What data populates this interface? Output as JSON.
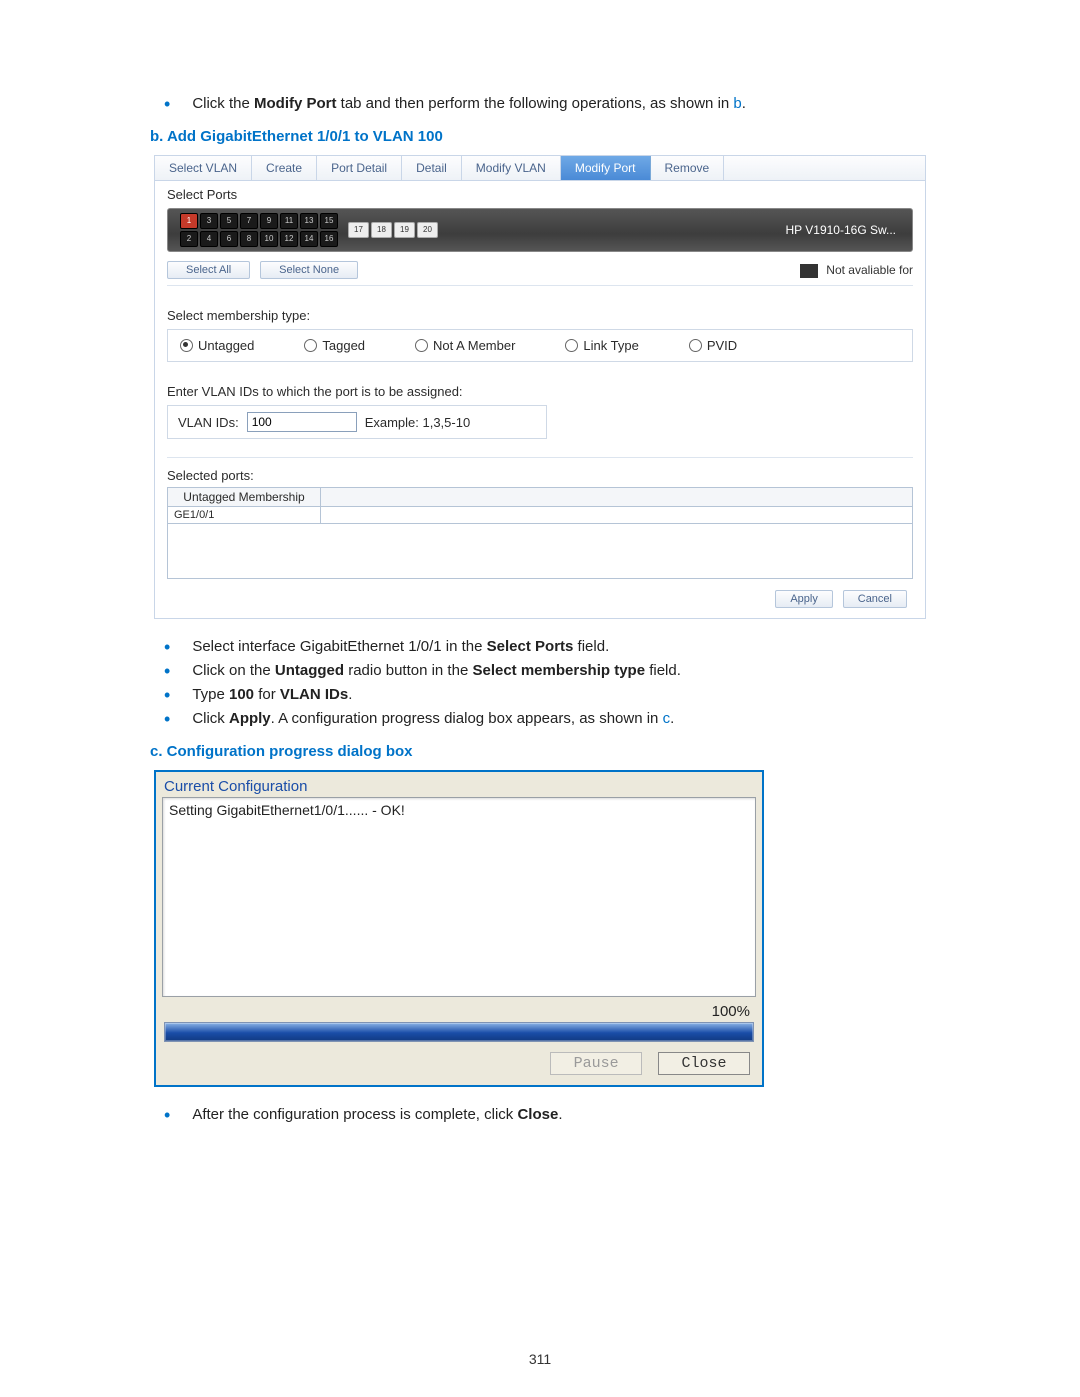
{
  "intro_bullet": {
    "pre": "Click the ",
    "bold1": "Modify Port",
    "mid": " tab and then perform the following operations, as shown in ",
    "ref": "b",
    "post": "."
  },
  "step_b": "b.    Add GigabitEthernet 1/0/1 to VLAN 100",
  "tabs": {
    "select_vlan": "Select VLAN",
    "create": "Create",
    "port_detail": "Port Detail",
    "detail": "Detail",
    "modify_vlan": "Modify VLAN",
    "modify_port": "Modify Port",
    "remove": "Remove"
  },
  "select_ports_label": "Select Ports",
  "switch_name": "HP V1910-16G Sw...",
  "ports_top": [
    "1",
    "3",
    "5",
    "7",
    "9",
    "11",
    "13",
    "15"
  ],
  "ports_bottom": [
    "2",
    "4",
    "6",
    "8",
    "10",
    "12",
    "14",
    "16"
  ],
  "ports_ext": [
    "17",
    "18",
    "19",
    "20"
  ],
  "ports_selected": [
    "1"
  ],
  "select_all": "Select All",
  "select_none": "Select None",
  "not_available": "Not avaliable for",
  "membership_label": "Select membership type:",
  "membership": {
    "untagged": "Untagged",
    "tagged": "Tagged",
    "not_member": "Not A Member",
    "link_type": "Link Type",
    "pvid": "PVID",
    "selected": "untagged"
  },
  "enter_vlan_label": "Enter VLAN IDs to which the port is to be assigned:",
  "vlan_ids_label": "VLAN IDs:",
  "vlan_ids_value": "100",
  "vlan_example": "Example: 1,3,5-10",
  "selected_ports_label": "Selected ports:",
  "selected_header": "Untagged Membership",
  "selected_row": "GE1/0/1",
  "apply": "Apply",
  "cancel": "Cancel",
  "after_b_bullets": [
    {
      "pre": "Select interface GigabitEthernet 1/0/1 in the ",
      "bold": "Select Ports",
      "post": " field."
    },
    {
      "pre": "Click on the ",
      "bold": "Untagged",
      "mid": " radio button in the ",
      "bold2": "Select membership type",
      "post": " field."
    },
    {
      "pre": "Type ",
      "bold": "100",
      "mid": " for ",
      "bold2": "VLAN IDs",
      "post": "."
    },
    {
      "pre": "Click ",
      "bold": "Apply",
      "mid": ". A configuration progress dialog box appears, as shown in ",
      "ref": "c",
      "post": "."
    }
  ],
  "step_c": "c.    Configuration progress dialog box",
  "dialog": {
    "title": "Current Configuration",
    "line": "Setting GigabitEthernet1/0/1...... - OK!",
    "percent": "100%",
    "pause": "Pause",
    "close": "Close"
  },
  "after_c_bullet": {
    "pre": "After the configuration process is complete, click ",
    "bold": "Close",
    "post": "."
  },
  "page_number": "311"
}
